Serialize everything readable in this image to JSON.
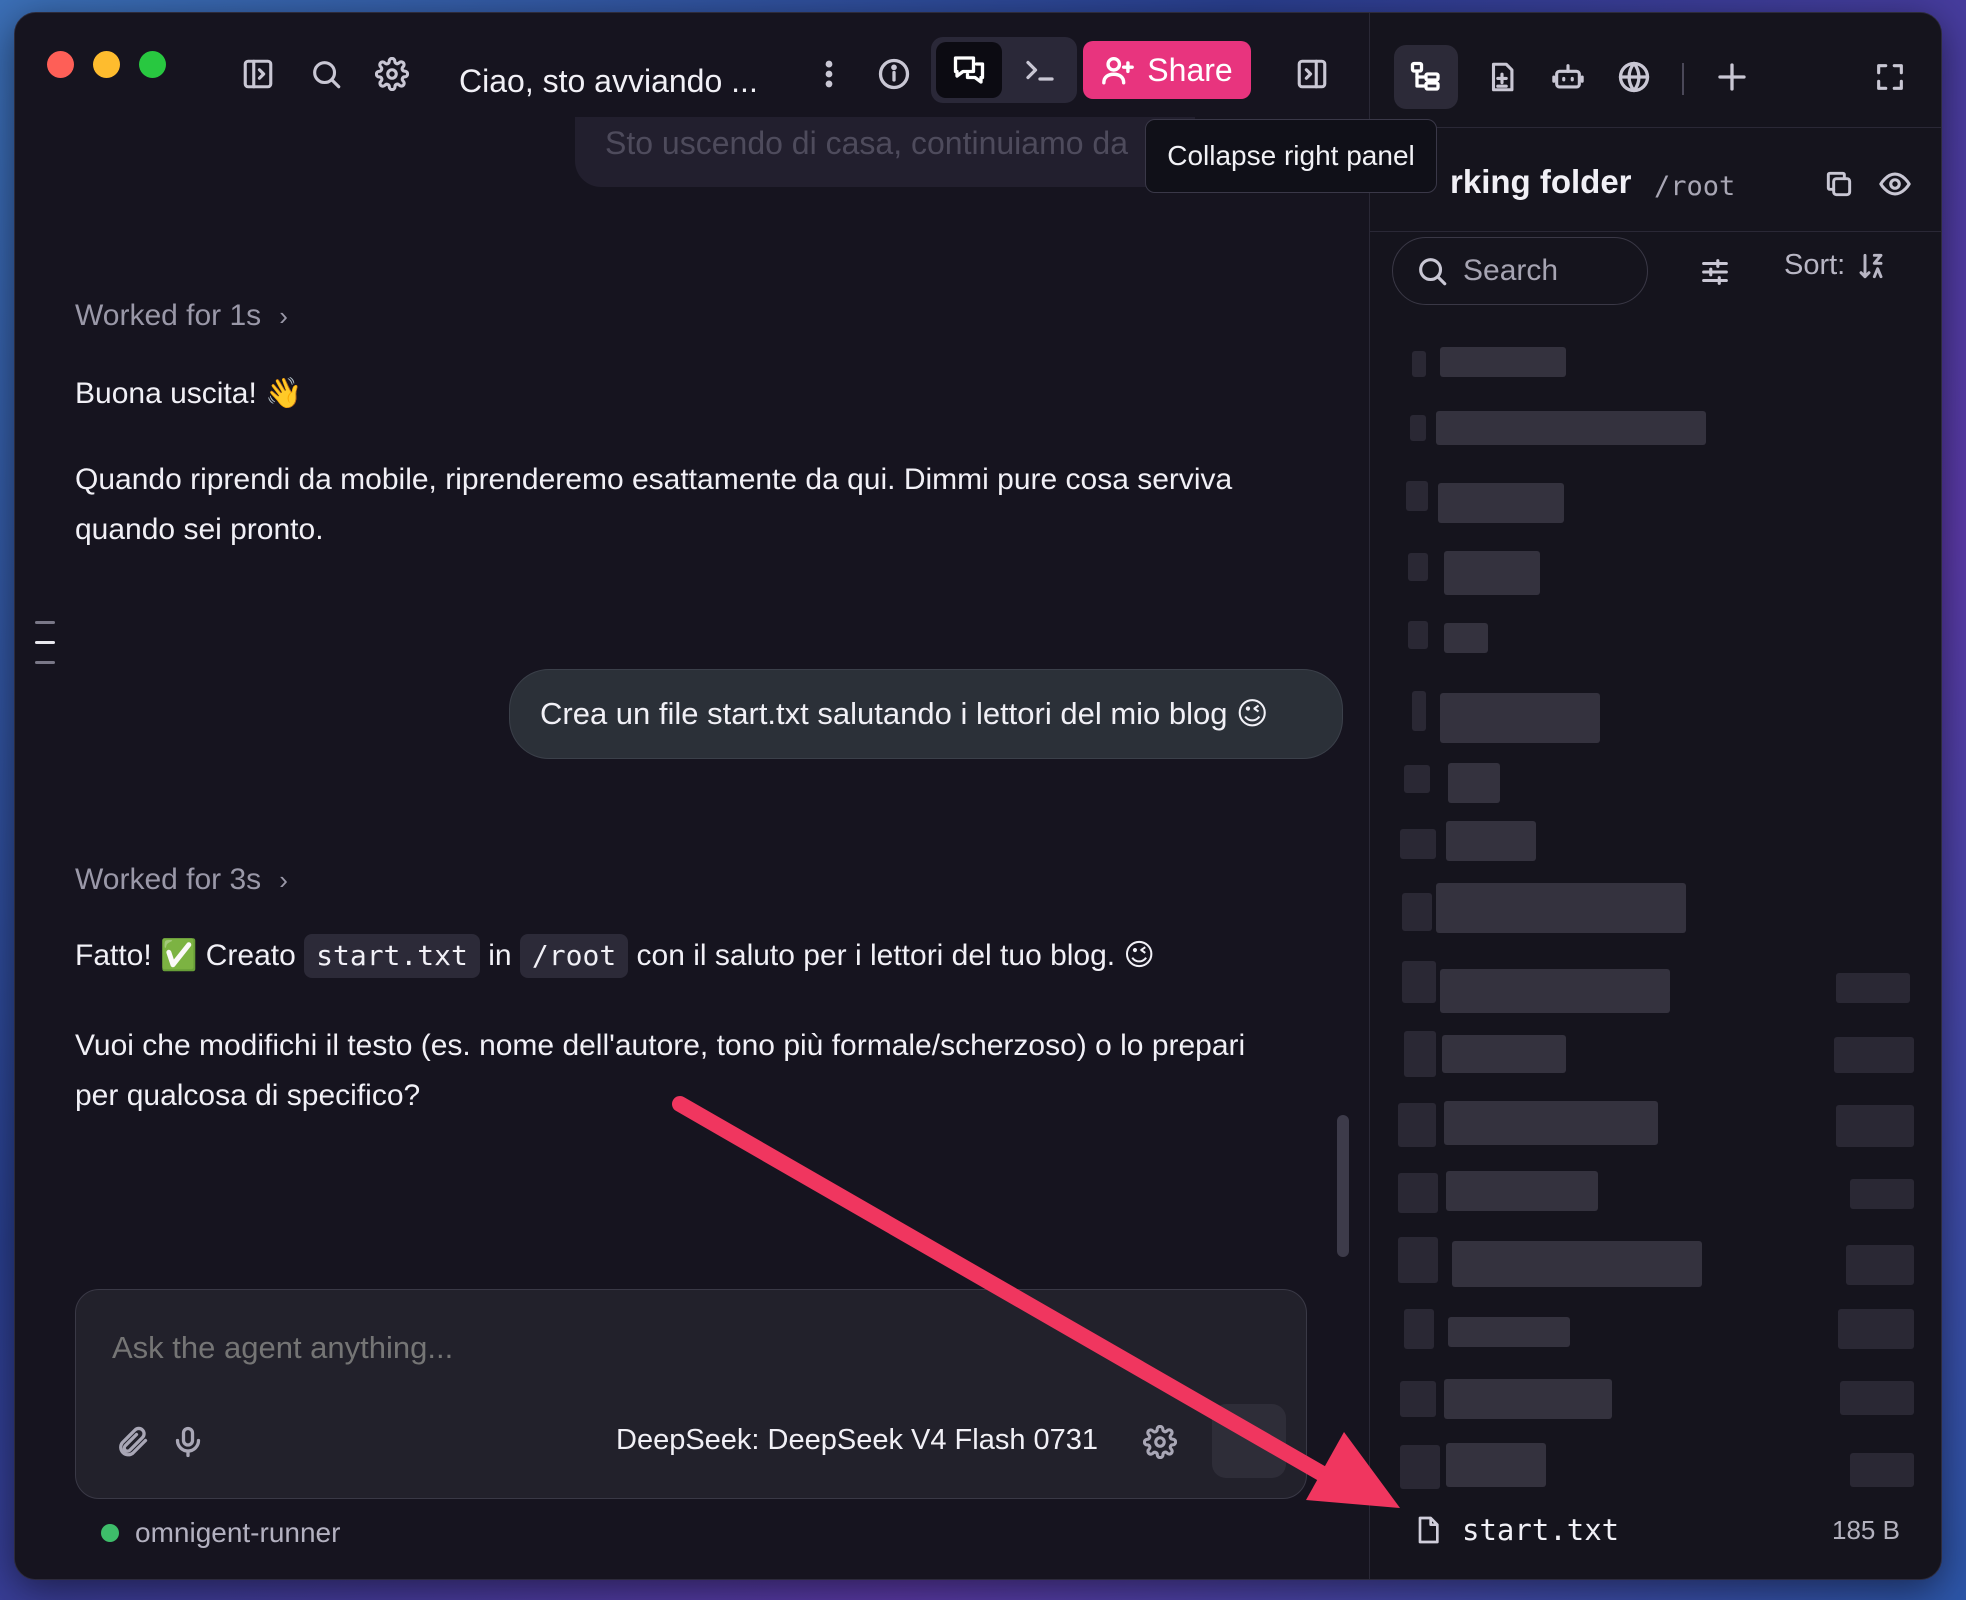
{
  "titlebar": {
    "title": "Ciao, sto avviando ...",
    "share_label": "Share",
    "tooltip": "Collapse right panel",
    "icons": [
      "sidebar-icon",
      "search-icon",
      "gear-icon",
      "more-vertical-icon",
      "info-icon",
      "chat-icon",
      "terminal-icon",
      "collapse-panel-icon"
    ],
    "right_icons": [
      "file-tree-icon",
      "new-file-icon",
      "robot-icon",
      "globe-icon",
      "plus-icon",
      "fullscreen-icon"
    ]
  },
  "chat": {
    "ghost_message": "Sto uscendo di casa, continuiamo da",
    "block1": {
      "worked": "Worked for 1s",
      "line1": "Buona uscita! 👋",
      "line2": "Quando riprendi da mobile, riprenderemo esattamente da qui. Dimmi pure cosa serviva quando sei pronto."
    },
    "user_message": "Crea un file start.txt salutando i lettori del mio blog 😉",
    "block2": {
      "worked": "Worked for 3s",
      "fatto": "Fatto! ✅ Creato",
      "file_code": "start.txt",
      "in_word": "in",
      "path_code": "/root",
      "rest": "con il saluto per i lettori del tuo blog. 😉",
      "question": "Vuoi che modifichi il testo (es. nome dell'autore, tono più formale/scherzoso) o lo prepari per qualcosa di specifico?"
    }
  },
  "composer": {
    "placeholder": "Ask the agent anything...",
    "model": "DeepSeek: DeepSeek V4 Flash 0731"
  },
  "status": {
    "runner": "omnigent-runner",
    "runner_color": "#3ebd6a"
  },
  "files_panel": {
    "title": "Working folder",
    "title_visible": "rking folder",
    "path": "/root",
    "search_placeholder": "Search",
    "sort_label": "Sort:",
    "file": {
      "name": "start.txt",
      "size": "185 B"
    }
  },
  "colors": {
    "accent": "#e8347e",
    "arrow": "#f0365f",
    "window_bg": "#16141f"
  }
}
